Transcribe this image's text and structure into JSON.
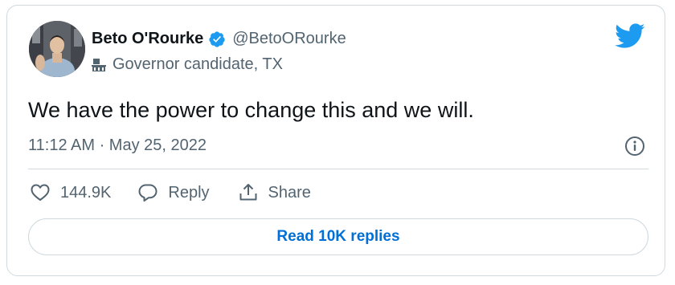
{
  "author": {
    "display_name": "Beto O'Rourke",
    "handle": "@BetoORourke",
    "label": "Governor candidate, TX",
    "verified_color": "#1d9bf0"
  },
  "tweet": {
    "text": "We have the power to change this and we will.",
    "timestamp": "11:12 AM · May 25, 2022"
  },
  "actions": {
    "like_count": "144.9K",
    "reply_label": "Reply",
    "share_label": "Share"
  },
  "footer": {
    "read_replies_label": "Read 10K replies"
  },
  "colors": {
    "brand": "#1d9bf0",
    "link": "#006fd6",
    "secondary_text": "#536471",
    "border": "#cfd9de"
  },
  "icons": [
    "verified-badge-icon",
    "government-building-icon",
    "twitter-bird-icon",
    "info-icon",
    "heart-icon",
    "reply-icon",
    "share-icon"
  ]
}
